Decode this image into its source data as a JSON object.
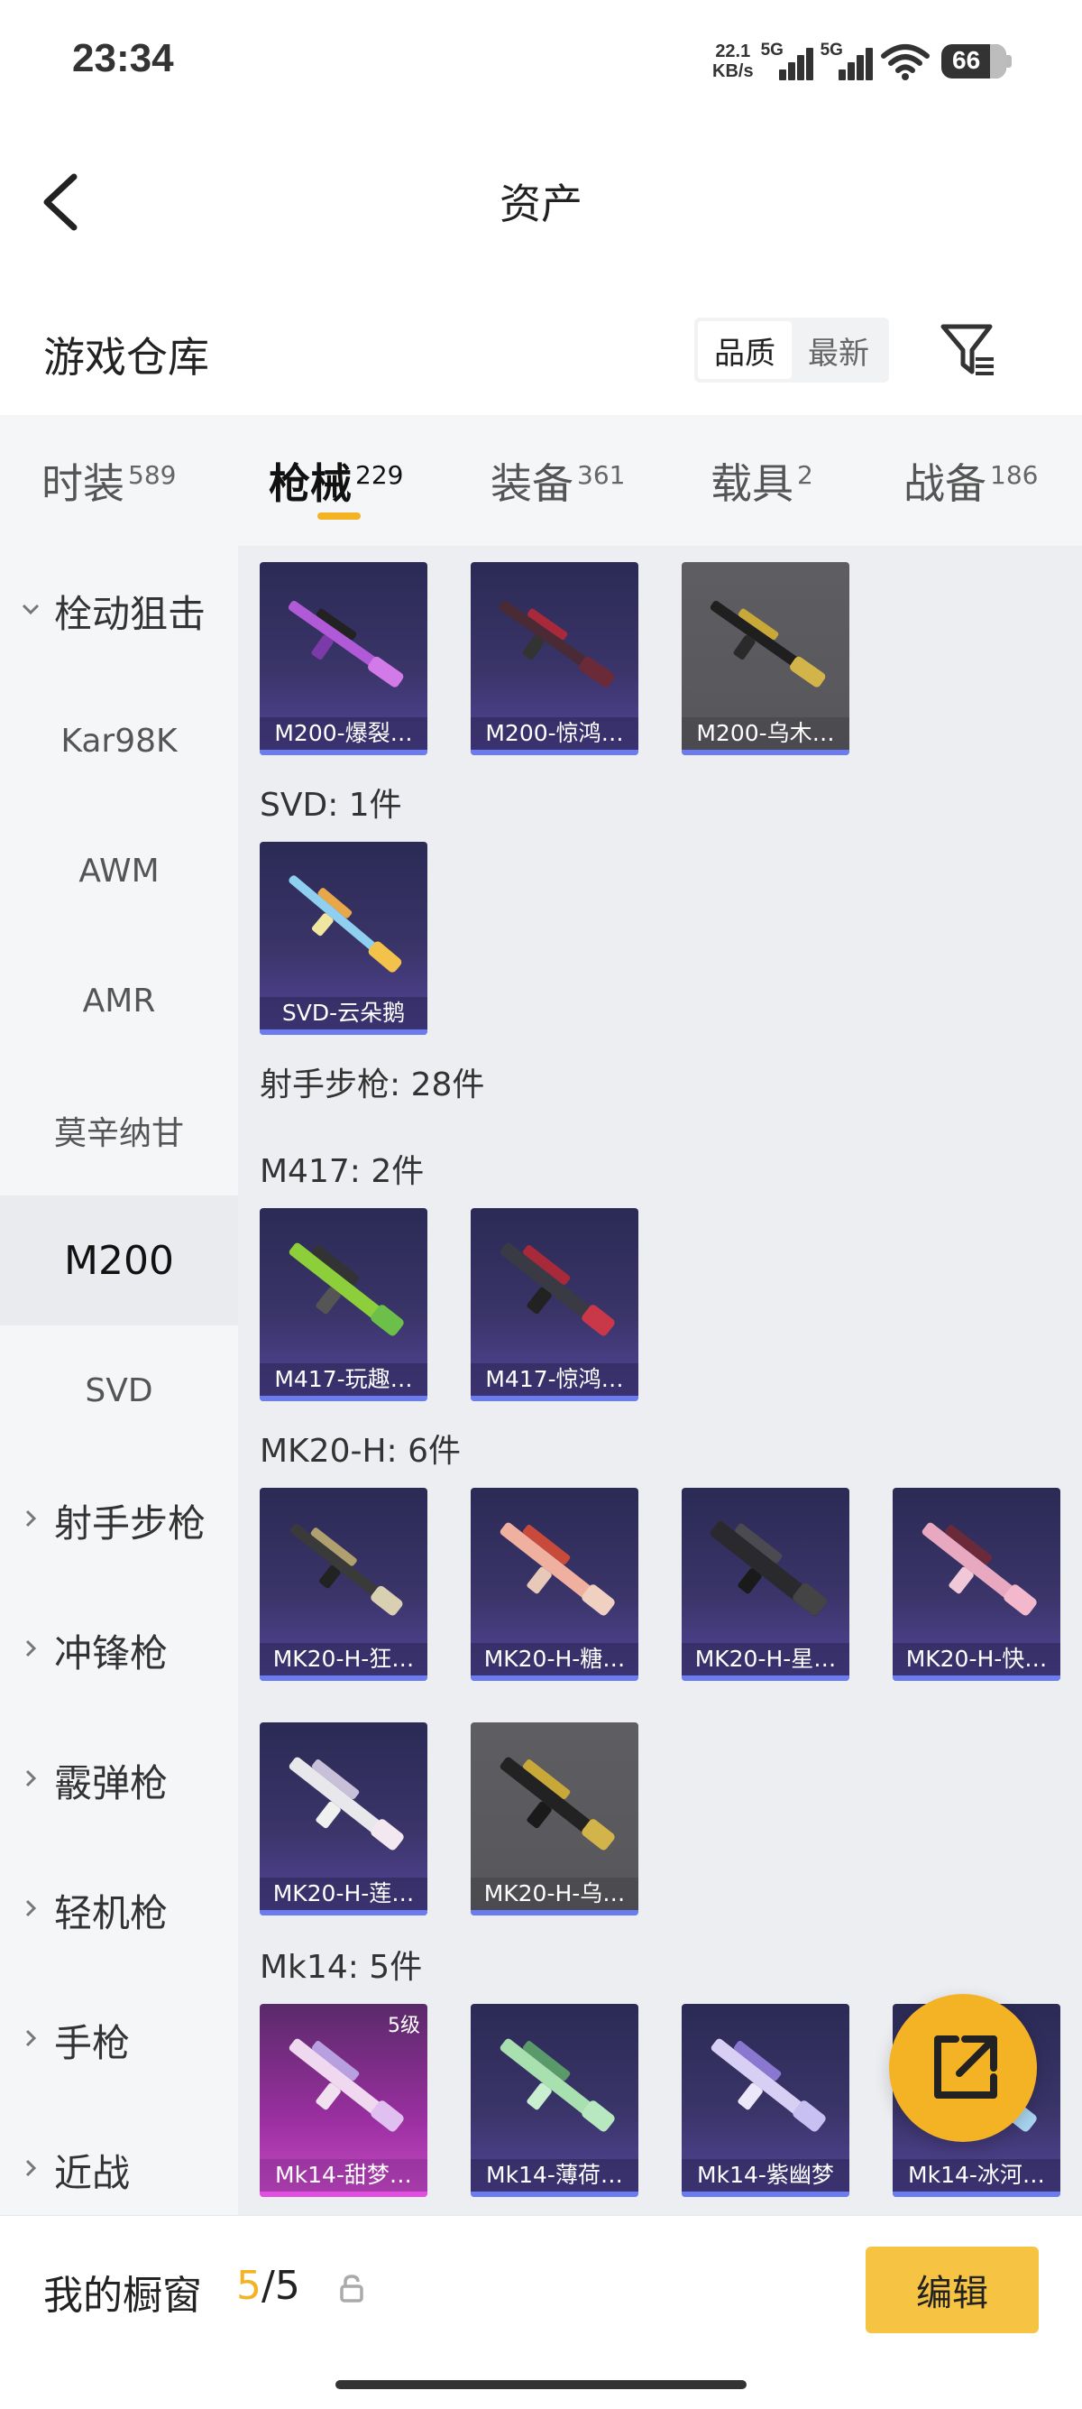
{
  "status_bar": {
    "time": "23:34",
    "net_speed_value": "22.1",
    "net_speed_unit": "KB/s",
    "sim1_label": "5G",
    "sim2_label": "5G",
    "battery": "66"
  },
  "header": {
    "title": "资产"
  },
  "warehouse": {
    "title": "游戏仓库",
    "sort_options": [
      "品质",
      "最新"
    ],
    "active_sort": "品质"
  },
  "category_tabs": [
    {
      "label": "时装",
      "count": "589"
    },
    {
      "label": "枪械",
      "count": "229",
      "active": true
    },
    {
      "label": "装备",
      "count": "361"
    },
    {
      "label": "载具",
      "count": "2"
    },
    {
      "label": "战备",
      "count": "186"
    }
  ],
  "left_nav": [
    {
      "label": "栓动狙击",
      "type": "group",
      "expanded": true
    },
    {
      "label": "Kar98K"
    },
    {
      "label": "AWM"
    },
    {
      "label": "AMR"
    },
    {
      "label": "莫辛纳甘"
    },
    {
      "label": "M200",
      "selected": true
    },
    {
      "label": "SVD"
    },
    {
      "label": "射手步枪",
      "type": "group"
    },
    {
      "label": "冲锋枪",
      "type": "group"
    },
    {
      "label": "霰弹枪",
      "type": "group"
    },
    {
      "label": "轻机枪",
      "type": "group"
    },
    {
      "label": "手枪",
      "type": "group"
    },
    {
      "label": "近战",
      "type": "group"
    }
  ],
  "sections": {
    "svd": "SVD: 1件",
    "marksman": "射手步枪: 28件",
    "m417": "M417: 2件",
    "mk20h": "MK20-H: 6件",
    "mk14": "Mk14: 5件"
  },
  "items": {
    "m200": [
      "M200-爆裂…",
      "M200-惊鸿…",
      "M200-乌木…"
    ],
    "svd": [
      "SVD-云朵鹅"
    ],
    "m417": [
      "M417-玩趣…",
      "M417-惊鸿…"
    ],
    "mk20h": [
      "MK20-H-狂…",
      "MK20-H-糖…",
      "MK20-H-星…",
      "MK20-H-快…",
      "MK20-H-莲…",
      "MK20-H-乌…"
    ],
    "mk14": [
      "Mk14-甜梦…",
      "Mk14-薄荷…",
      "Mk14-紫幽梦",
      "Mk14-冰河…"
    ],
    "mk14_badge": "5级"
  },
  "bottom_bar": {
    "label": "我的橱窗",
    "current": "5",
    "total": "/5",
    "edit_label": "编辑"
  },
  "colors": {
    "accent": "#f4b324",
    "card_purple": "#3a3468",
    "card_gray": "#5e5e62",
    "card_pink": "#c84bc6"
  }
}
